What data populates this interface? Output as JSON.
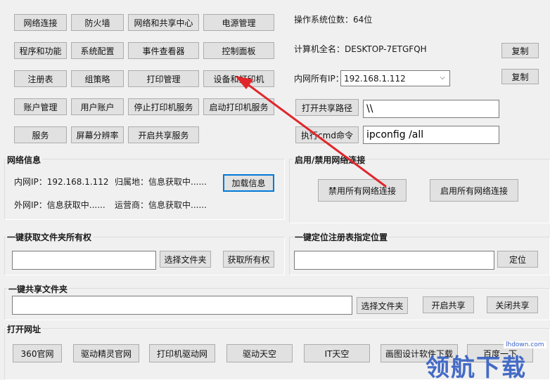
{
  "tools": {
    "row1": [
      "网络连接",
      "防火墙",
      "网络和共享中心",
      "电源管理"
    ],
    "row2": [
      "程序和功能",
      "系统配置",
      "事件查看器",
      "控制面板"
    ],
    "row3": [
      "注册表",
      "组策略",
      "打印管理",
      "设备和打印机"
    ],
    "row4": [
      "账户管理",
      "用户账户",
      "停止打印机服务",
      "启动打印机服务"
    ],
    "row5": [
      "服务",
      "屏幕分辨率",
      "开启共享服务"
    ]
  },
  "system": {
    "os_bits": "操作系统位数：64位",
    "computer_name": "计算机全名：DESKTOP-7ETGFQH",
    "copy_label": "复制",
    "lan_ip_label": "内网所有IP：",
    "lan_ip_value": "192.168.1.112",
    "copy2_label": "复制",
    "open_share_label": "打开共享路径",
    "share_path_value": "\\\\",
    "run_cmd_label": "执行cmd命令",
    "cmd_value": "ipconfig /all"
  },
  "network_info": {
    "title": "网络信息",
    "lan_ip": "内网IP：192.168.1.112",
    "location": "归属地：信息获取中......",
    "load_label": "加载信息",
    "wan_ip": "外网IP：信息获取中......",
    "isp": "运营商：信息获取中......"
  },
  "network_toggle": {
    "title": "启用/禁用网络连接",
    "disable_label": "禁用所有网络连接",
    "enable_label": "启用所有网络连接"
  },
  "ownership": {
    "title": "一键获取文件夹所有权",
    "path_value": "",
    "choose_label": "选择文件夹",
    "take_label": "获取所有权"
  },
  "registry": {
    "title": "一键定位注册表指定位置",
    "path_value": "",
    "locate_label": "定位"
  },
  "share": {
    "title": "一键共享文件夹",
    "path_value": "",
    "choose_label": "选择文件夹",
    "on_label": "开启共享",
    "off_label": "关闭共享"
  },
  "urls": {
    "title": "打开网址",
    "items": [
      "360官网",
      "驱动精灵官网",
      "打印机驱动网",
      "驱动天空",
      "IT天空",
      "画图设计软件下载",
      "百度一下"
    ]
  },
  "watermark": {
    "brand": "领航下载",
    "site": "lhdown.com"
  },
  "colors": {
    "arrow": "#e0262b",
    "focus": "#0078d7",
    "watermark": "#3b64c4"
  }
}
